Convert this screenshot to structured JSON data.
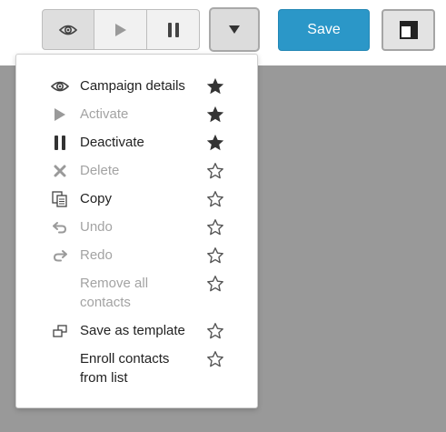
{
  "toolbar": {
    "view_icon": "eye-icon",
    "play_icon": "play-icon",
    "pause_icon": "pause-icon",
    "dropdown_icon": "caret-down-icon",
    "save_label": "Save",
    "layout_icon": "layout-icon"
  },
  "menu": {
    "items": [
      {
        "label": "Campaign details",
        "icon": "eye-icon",
        "enabled": true,
        "favorite": true
      },
      {
        "label": "Activate",
        "icon": "play-icon",
        "enabled": false,
        "favorite": true
      },
      {
        "label": "Deactivate",
        "icon": "pause-icon",
        "enabled": true,
        "favorite": true
      },
      {
        "label": "Delete",
        "icon": "close-icon",
        "enabled": false,
        "favorite": false
      },
      {
        "label": "Copy",
        "icon": "copy-icon",
        "enabled": true,
        "favorite": false
      },
      {
        "label": "Undo",
        "icon": "undo-icon",
        "enabled": false,
        "favorite": false
      },
      {
        "label": "Redo",
        "icon": "redo-icon",
        "enabled": false,
        "favorite": false
      },
      {
        "label": "Remove all contacts",
        "line1": "Remove all",
        "line2": "contacts",
        "icon": "none",
        "enabled": false,
        "favorite": false
      },
      {
        "label": "Save as template",
        "icon": "template-icon",
        "enabled": true,
        "favorite": false
      },
      {
        "label": "Enroll contacts from list",
        "line1": "Enroll contacts",
        "line2": "from list",
        "icon": "none",
        "enabled": true,
        "favorite": false
      }
    ]
  },
  "colors": {
    "accent": "#2b97c8",
    "overlay": "#999999",
    "text": "#222222",
    "disabled_text": "#a3a3a3",
    "star": "#333333",
    "star_outline": "#555555"
  }
}
